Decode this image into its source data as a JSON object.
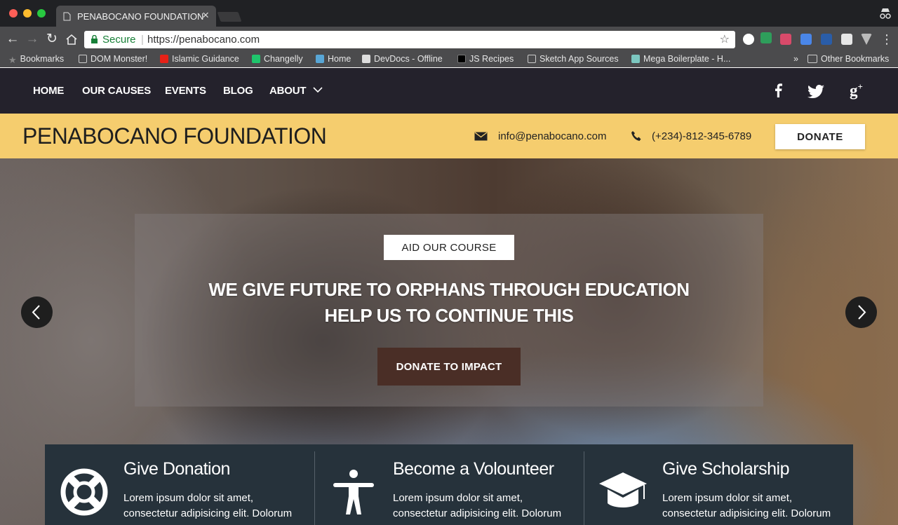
{
  "browser": {
    "tab_title": "PENABOCANO FOUNDATION",
    "tab_close": "×",
    "secure_label": "Secure",
    "url": "https://penabocano.com",
    "bookmarks": [
      {
        "label": "Bookmarks",
        "icon": "star-icon"
      },
      {
        "label": "DOM Monster!",
        "icon": "page-icon"
      },
      {
        "label": "Islamic Guidance",
        "icon": "youtube-icon"
      },
      {
        "label": "Changelly",
        "icon": "changelly-icon"
      },
      {
        "label": "Home",
        "icon": "home-bookmark-icon"
      },
      {
        "label": "DevDocs - Offline",
        "icon": "devdocs-icon"
      },
      {
        "label": "JS Recipes",
        "icon": "terminal-icon"
      },
      {
        "label": "Sketch App Sources",
        "icon": "page-icon"
      },
      {
        "label": "Mega Boilerplate - H...",
        "icon": "boilerplate-icon"
      }
    ],
    "more_bookmarks": "»",
    "other_bookmarks": "Other Bookmarks"
  },
  "site": {
    "nav": {
      "home": "HOME",
      "causes": "OUR CAUSES",
      "events": "EVENTS",
      "blog": "BLOG",
      "about": "ABOUT"
    },
    "social": {
      "facebook": "f",
      "twitter": "twitter",
      "googleplus": "g+"
    },
    "brand": "PENABOCANO FOUNDATION",
    "email": "info@penabocano.com",
    "phone": "(+234)-812-345-6789",
    "donate_label": "DONATE",
    "hero": {
      "tag_button": "AID OUR COURSE",
      "headline_line1": "WE GIVE FUTURE TO ORPHANS THROUGH EDUCATION",
      "headline_line2": "HELP US TO CONTINUE THIS",
      "cta_button": "DONATE TO IMPACT",
      "prev_arrow": "‹",
      "next_arrow": "›"
    },
    "features": [
      {
        "title": "Give Donation",
        "text": "Lorem ipsum dolor sit amet, consectetur adipisicing elit. Dolorum",
        "icon": "lifebuoy-icon"
      },
      {
        "title": "Become a Volounteer",
        "text": "Lorem ipsum dolor sit amet, consectetur adipisicing elit. Dolorum",
        "icon": "person-icon"
      },
      {
        "title": "Give Scholarship",
        "text": "Lorem ipsum dolor sit amet, consectetur adipisicing elit. Dolorum",
        "icon": "graduation-cap-icon"
      }
    ]
  },
  "colors": {
    "nav_bg": "#24222c",
    "info_bar": "#f5cd6e",
    "cta_bg": "#4a2e26",
    "features_bg": "#26323b"
  }
}
